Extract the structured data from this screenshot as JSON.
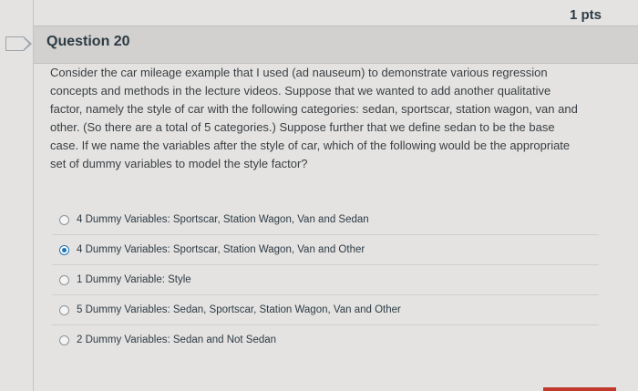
{
  "question": {
    "points": "1 pts",
    "title": "Question 20",
    "text": "Consider the car mileage example that I used (ad nauseum) to demonstrate various regression concepts and methods in the lecture videos. Suppose that we wanted to add another qualitative factor, namely the style of car with the following categories: sedan, sportscar, station wagon, van and other. (So there are a total of 5 categories.) Suppose further that we define sedan to be the base case. If we name the variables after the style of car, which of the following would be the appropriate set of dummy variables to model the style factor?"
  },
  "answers": [
    {
      "label": "4 Dummy Variables: Sportscar, Station Wagon, Van and Sedan",
      "selected": false
    },
    {
      "label": "4 Dummy Variables: Sportscar, Station Wagon, Van and Other",
      "selected": true
    },
    {
      "label": "1 Dummy Variable: Style",
      "selected": false
    },
    {
      "label": "5 Dummy Variables: Sedan, Sportscar, Station Wagon, Van and Other",
      "selected": false
    },
    {
      "label": "2 Dummy Variables: Sedan and Not Sedan",
      "selected": false
    }
  ],
  "colors": {
    "accent": "#1d73b4",
    "header_bg": "#d2d1cf",
    "text": "#2d3b45"
  },
  "icons": {
    "flag": "flag-icon",
    "radio": "radio-icon"
  }
}
